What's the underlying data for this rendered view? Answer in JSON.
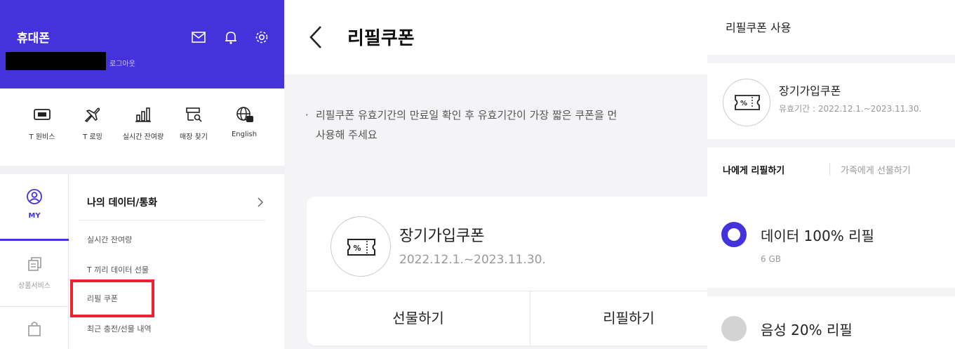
{
  "panel1": {
    "title": "휴대폰",
    "logout": "로그아웃",
    "header_icons": [
      "envelope-icon",
      "bell-icon",
      "gear-icon"
    ],
    "quick_menu": [
      {
        "label": "T 로밍",
        "icon": "plane-icon"
      },
      {
        "label": "실시간 잔여량",
        "icon": "bar-chart-icon"
      },
      {
        "label": "매장 찾기",
        "icon": "store-search-icon"
      },
      {
        "label": "English",
        "icon": "globe-en-icon"
      }
    ],
    "side_nav": [
      {
        "label": "MY",
        "icon": "person-icon"
      },
      {
        "label": "상품서비스",
        "icon": "copy-icon"
      },
      {
        "label": "",
        "icon": "bag-icon"
      }
    ],
    "menu_title": "나의 데이터/통화",
    "menu_items": [
      "실시간 잔여량",
      "T 끼리 데이터 선물",
      "리필 쿠폰",
      "최근 충전/선물 내역"
    ]
  },
  "panel2": {
    "title": "리필쿠폰",
    "notice": [
      "리필쿠폰 유효기간의 만료일 확인 후 유효기간이 가장 짧은 쿠폰을 먼",
      "사용해 주세요"
    ],
    "coupon": {
      "name": "장기가입쿠폰",
      "period": "2022.12.1.~2023.11.30."
    },
    "buttons": {
      "gift": "선물하기",
      "refill": "리필하기"
    }
  },
  "panel3": {
    "title": "리필쿠폰 사용",
    "coupon": {
      "name": "장기가입쿠폰",
      "period": "유효기간 : 2022.12.1.~2023.11.30."
    },
    "tabs": [
      "나에게 리필하기",
      "가족에게 선물하기"
    ],
    "options": [
      {
        "label": "데이터 100% 리필",
        "sub": "6 GB",
        "selected": true
      },
      {
        "label": "음성 20% 리필",
        "sub": "",
        "selected": false
      }
    ]
  },
  "colors": {
    "brand": "#4433dd",
    "highlight": "#ee2233"
  }
}
